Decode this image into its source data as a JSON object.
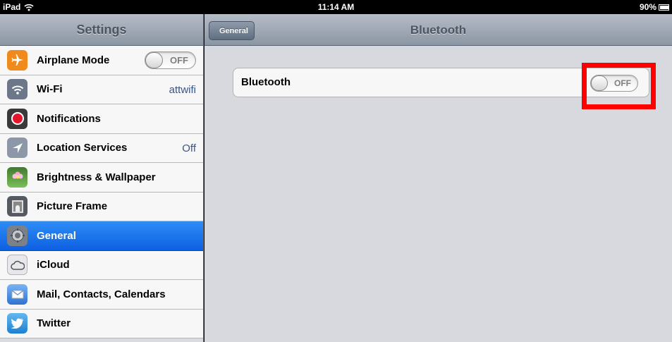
{
  "status_bar": {
    "device": "iPad",
    "wifi_icon": "wifi-icon",
    "time": "11:14 AM",
    "battery_percent": "90%",
    "battery_level": 0.9
  },
  "master": {
    "title": "Settings",
    "items": [
      {
        "label": "Airplane Mode",
        "icon": "airplane-icon",
        "color": "#f08a1c",
        "toggle": "OFF"
      },
      {
        "label": "Wi-Fi",
        "icon": "wifi-icon",
        "color": "#6c7889",
        "value": "attwifi"
      },
      {
        "label": "Notifications",
        "icon": "notifications-icon",
        "color": "#d0021b"
      },
      {
        "label": "Location Services",
        "icon": "location-arrow-icon",
        "color": "#8c97a8",
        "value": "Off"
      },
      {
        "label": "Brightness & Wallpaper",
        "icon": "brightness-flower-icon",
        "color": "#4f9a3d"
      },
      {
        "label": "Picture Frame",
        "icon": "picture-frame-icon",
        "color": "#555a60"
      },
      {
        "label": "General",
        "icon": "gear-icon",
        "color": "#7b818a",
        "selected": true
      },
      {
        "label": "iCloud",
        "icon": "cloud-icon",
        "color": "#e6e8ec"
      },
      {
        "label": "Mail, Contacts, Calendars",
        "icon": "mail-icon",
        "color": "#4a8ee0"
      },
      {
        "label": "Twitter",
        "icon": "twitter-bird-icon",
        "color": "#3d9ae0"
      }
    ]
  },
  "detail": {
    "back_label": "General",
    "title": "Bluetooth",
    "row_label": "Bluetooth",
    "toggle_text": "OFF"
  },
  "colors": {
    "highlight": "#ff0000",
    "selected_row": "#1a73ea"
  }
}
